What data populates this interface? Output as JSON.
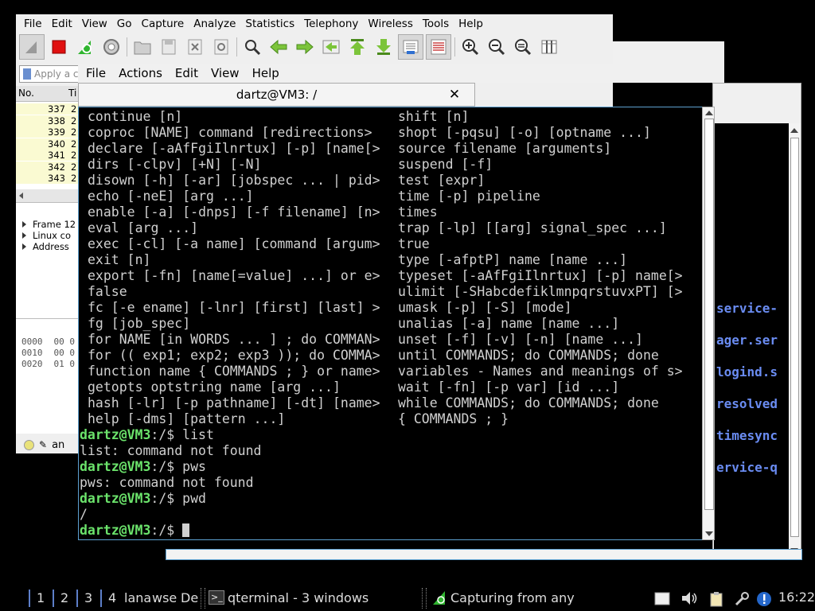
{
  "wireshark": {
    "menu": [
      "File",
      "Edit",
      "View",
      "Go",
      "Capture",
      "Analyze",
      "Statistics",
      "Telephony",
      "Wireless",
      "Tools",
      "Help"
    ],
    "filter_placeholder": "Apply a c",
    "packet_list": {
      "header": "No.",
      "header2": "Ti",
      "rows": [
        {
          "no": "337",
          "t": "2"
        },
        {
          "no": "338",
          "t": "2"
        },
        {
          "no": "339",
          "t": "2"
        },
        {
          "no": "340",
          "t": "2"
        },
        {
          "no": "341",
          "t": "2"
        },
        {
          "no": "342",
          "t": "2"
        },
        {
          "no": "343",
          "t": "2"
        }
      ]
    },
    "details": [
      "Frame 12",
      "Linux co",
      "Address"
    ],
    "bytes": [
      {
        "off": "0000",
        "hex": "00 0"
      },
      {
        "off": "0010",
        "hex": "00 0"
      },
      {
        "off": "0020",
        "hex": "01 0"
      }
    ],
    "status_text": "an"
  },
  "background_window": {
    "links": [
      "service-",
      "ager.ser",
      "logind.s",
      "resolved",
      "timesync",
      "ervice-q"
    ]
  },
  "terminal": {
    "menu": [
      "File",
      "Actions",
      "Edit",
      "View",
      "Help"
    ],
    "tab_title": "dartz@VM3: /",
    "help_left": [
      "continue [n]",
      "coproc [NAME] command [redirections>",
      "declare [-aAfFgiIlnrtux] [-p] [name[>",
      "dirs [-clpv] [+N] [-N]",
      "disown [-h] [-ar] [jobspec ... | pid>",
      "echo [-neE] [arg ...]",
      "enable [-a] [-dnps] [-f filename] [n>",
      "eval [arg ...]",
      "exec [-cl] [-a name] [command [argum>",
      "exit [n]",
      "export [-fn] [name[=value] ...] or e>",
      "false",
      "fc [-e ename] [-lnr] [first] [last] >",
      "fg [job_spec]",
      "for NAME [in WORDS ... ] ; do COMMAN>",
      "for (( exp1; exp2; exp3 )); do COMMA>",
      "function name { COMMANDS ; } or name>",
      "getopts optstring name [arg ...]",
      "hash [-lr] [-p pathname] [-dt] [name>",
      "help [-dms] [pattern ...]"
    ],
    "help_right": [
      "shift [n]",
      "shopt [-pqsu] [-o] [optname ...]",
      "source filename [arguments]",
      "suspend [-f]",
      "test [expr]",
      "time [-p] pipeline",
      "times",
      "trap [-lp] [[arg] signal_spec ...]",
      "true",
      "type [-afptP] name [name ...]",
      "typeset [-aAfFgiIlnrtux] [-p] name[>",
      "ulimit [-SHabcdefiklmnpqrstuvxPT] [>",
      "umask [-p] [-S] [mode]",
      "unalias [-a] name [name ...]",
      "unset [-f] [-v] [-n] [name ...]",
      "until COMMANDS; do COMMANDS; done",
      "variables - Names and meanings of s>",
      "wait [-fn] [-p var] [id ...]",
      "while COMMANDS; do COMMANDS; done",
      "{ COMMANDS ; }"
    ],
    "prompt": "dartz@VM3",
    "prompt_path": ":/$ ",
    "session": [
      {
        "cmd": "list"
      },
      {
        "out": "list: command not found"
      },
      {
        "cmd": "pws"
      },
      {
        "out": "pws: command not found"
      },
      {
        "cmd": "pwd"
      },
      {
        "out": "/"
      },
      {
        "cmd": ""
      }
    ]
  },
  "taskbar": {
    "workspaces": [
      "1",
      "2",
      "3",
      "4"
    ],
    "items": [
      "lana",
      "wse",
      "De"
    ],
    "terminal_task": "qterminal - 3 windows",
    "capture_task": "Capturing from any",
    "clock": "16:22"
  },
  "colors": {
    "prompt": "#6be36b",
    "terminal_text": "#d0d0d0",
    "link": "#6a8cf2",
    "packet_row": "#fafad2"
  }
}
